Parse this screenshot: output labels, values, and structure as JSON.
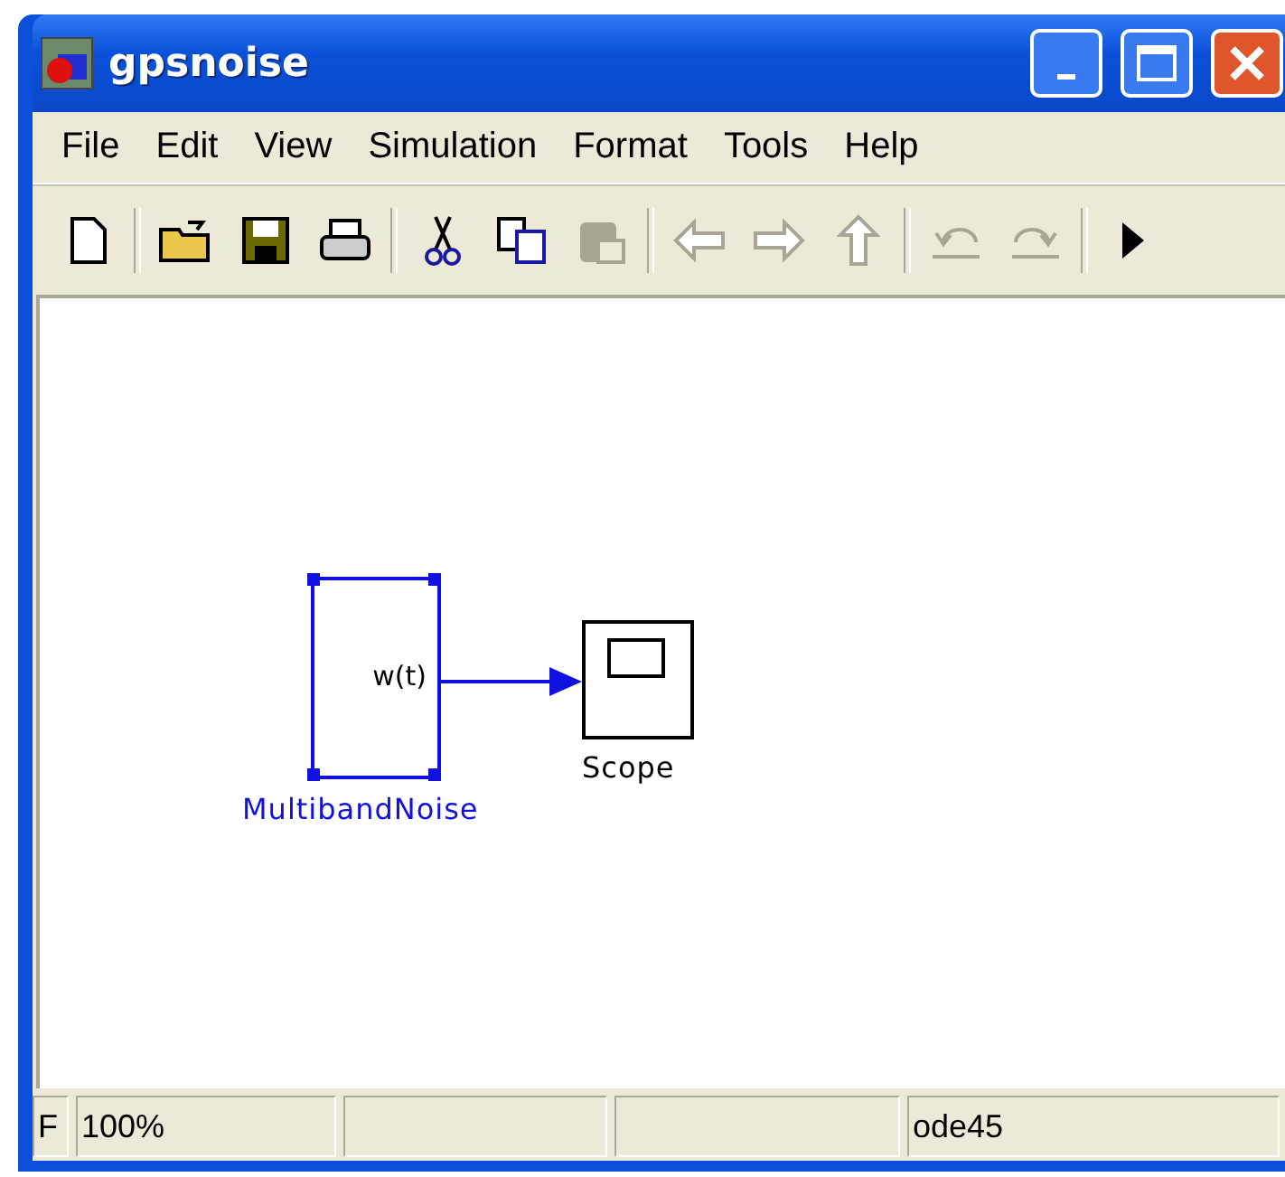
{
  "window": {
    "title": "gpsnoise"
  },
  "menu": [
    "File",
    "Edit",
    "View",
    "Simulation",
    "Format",
    "Tools",
    "Help"
  ],
  "toolbar": [
    {
      "kind": "new",
      "disabled": false
    },
    {
      "kind": "sep"
    },
    {
      "kind": "open",
      "disabled": false
    },
    {
      "kind": "save",
      "disabled": false
    },
    {
      "kind": "print",
      "disabled": false
    },
    {
      "kind": "sep"
    },
    {
      "kind": "cut",
      "disabled": false
    },
    {
      "kind": "copy",
      "disabled": false
    },
    {
      "kind": "paste",
      "disabled": true
    },
    {
      "kind": "sep"
    },
    {
      "kind": "back",
      "disabled": true
    },
    {
      "kind": "forward",
      "disabled": true
    },
    {
      "kind": "up",
      "disabled": true
    },
    {
      "kind": "sep"
    },
    {
      "kind": "undo",
      "disabled": true
    },
    {
      "kind": "redo",
      "disabled": true
    },
    {
      "kind": "sep"
    },
    {
      "kind": "play",
      "disabled": false
    }
  ],
  "blocks": [
    {
      "kind": "noise",
      "name": "MultibandNoise",
      "port": "w(t)",
      "selected": true
    },
    {
      "kind": "scope",
      "name": "Scope",
      "selected": false
    }
  ],
  "status_bar": [
    {
      "kind": "text",
      "text": "F"
    },
    {
      "kind": "text",
      "text": "100%"
    },
    {
      "kind": "empty"
    },
    {
      "kind": "empty"
    },
    {
      "kind": "text",
      "text": "ode45"
    }
  ]
}
